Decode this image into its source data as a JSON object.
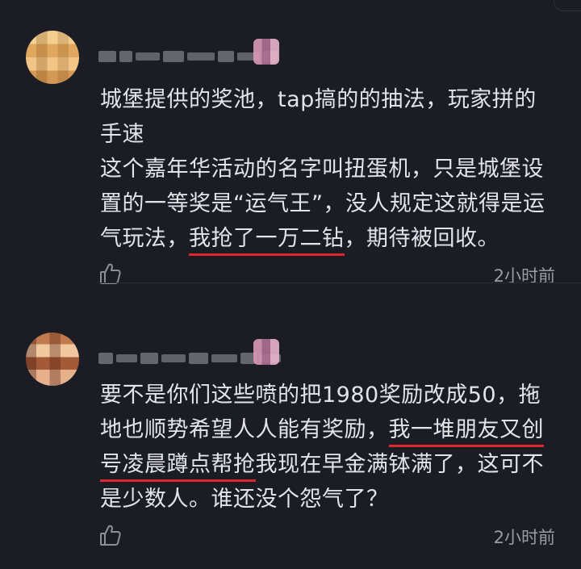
{
  "comments": [
    {
      "lines": [
        "城堡提供的奖池，tap搞的的抽法，玩家拼的",
        "手速",
        "这个嘉年华活动的名字叫扭蛋机，只是城堡设",
        "置的一等奖是“运气王”，没人规定这就得是运"
      ],
      "line5_before": "气玩法，",
      "line5_highlight": "我抢了一万二钻",
      "line5_after": "，期待被回收。",
      "time": "2小时前",
      "like_icon": "thumbs-up-icon"
    },
    {
      "line1": "要不是你们这些喷的把1980奖励改成50，拖",
      "line2_before": "地也顺势希望人人能有奖励，",
      "line2_highlight": "我一堆朋友又创",
      "line3_highlight": "号凌晨蹲点帮抢",
      "line3_after": "我现在早金满钵满了，这可不",
      "line4": "是少数人。谁还没个怨气了？",
      "time": "2小时前",
      "like_icon": "thumbs-up-icon"
    }
  ],
  "colors": {
    "background": "#1b1c24",
    "text": "#e4e4e8",
    "muted": "#9b9ba6",
    "highlight_underline": "#e0262f"
  }
}
